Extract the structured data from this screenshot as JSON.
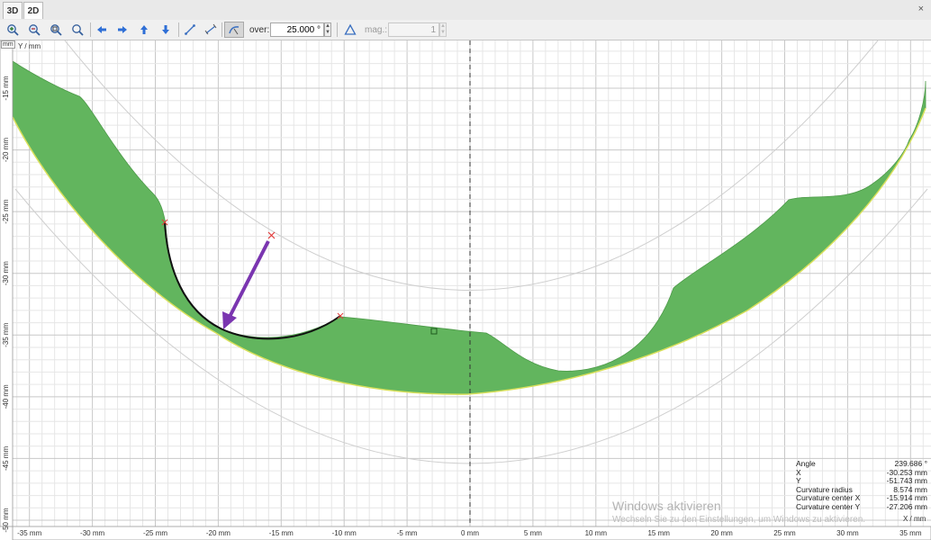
{
  "tabs": [
    {
      "label": "3D",
      "active": false
    },
    {
      "label": "2D",
      "active": true
    }
  ],
  "window": {
    "close_glyph": "×"
  },
  "toolbar": {
    "over_label": "over:",
    "over_value": "25.000 °",
    "mag_label": "mag.:",
    "mag_value": "1"
  },
  "icons": {
    "zoom_in": "zoom-in-icon",
    "zoom_out": "zoom-out-icon",
    "zoom_window": "zoom-window-icon",
    "zoom_fit": "zoom-fit-icon",
    "arrow_left": "arrow-left-icon",
    "arrow_right": "arrow-right-icon",
    "arrow_up": "arrow-up-icon",
    "arrow_down": "arrow-down-icon",
    "measure_distance": "measure-distance-icon",
    "measure_dimension": "measure-dimension-icon",
    "curvature_tool": "curvature-tool-icon",
    "triangle_tool": "triangle-icon"
  },
  "axes": {
    "x_unit": "X / mm",
    "y_unit": "Y / mm",
    "corner_unit": "mm",
    "x_ticks": [
      "-35 mm",
      "-30 mm",
      "-25 mm",
      "-20 mm",
      "-15 mm",
      "-10 mm",
      "-5 mm",
      "0 mm",
      "5 mm",
      "10 mm",
      "15 mm",
      "20 mm",
      "25 mm",
      "30 mm",
      "35 mm"
    ],
    "y_ticks": [
      "-15 mm",
      "-20 mm",
      "-25 mm",
      "-30 mm",
      "-35 mm",
      "-40 mm",
      "-45 mm",
      "-50 mm"
    ]
  },
  "readout": [
    {
      "label": "Angle",
      "value": "239.686 °"
    },
    {
      "label": "X",
      "value": "-30.253 mm"
    },
    {
      "label": "Y",
      "value": "-51.743 mm"
    },
    {
      "label": "Curvature radius",
      "value": "8.574 mm"
    },
    {
      "label": "Curvature center X",
      "value": "-15.914 mm"
    },
    {
      "label": "Curvature center Y",
      "value": "-27.206 mm"
    }
  ],
  "watermark": {
    "line1": "Windows aktivieren",
    "line2": "Wechseln Sie zu den Einstellungen, um Windows zu aktivieren."
  },
  "colors": {
    "fill": "#62b55e",
    "edge_yellow": "#d9e05c",
    "arc": "#111111",
    "arrow": "#7a35b0",
    "marker": "#e23b3b",
    "grid_minor": "#e3e3e3",
    "grid_major": "#c8c8c8"
  }
}
